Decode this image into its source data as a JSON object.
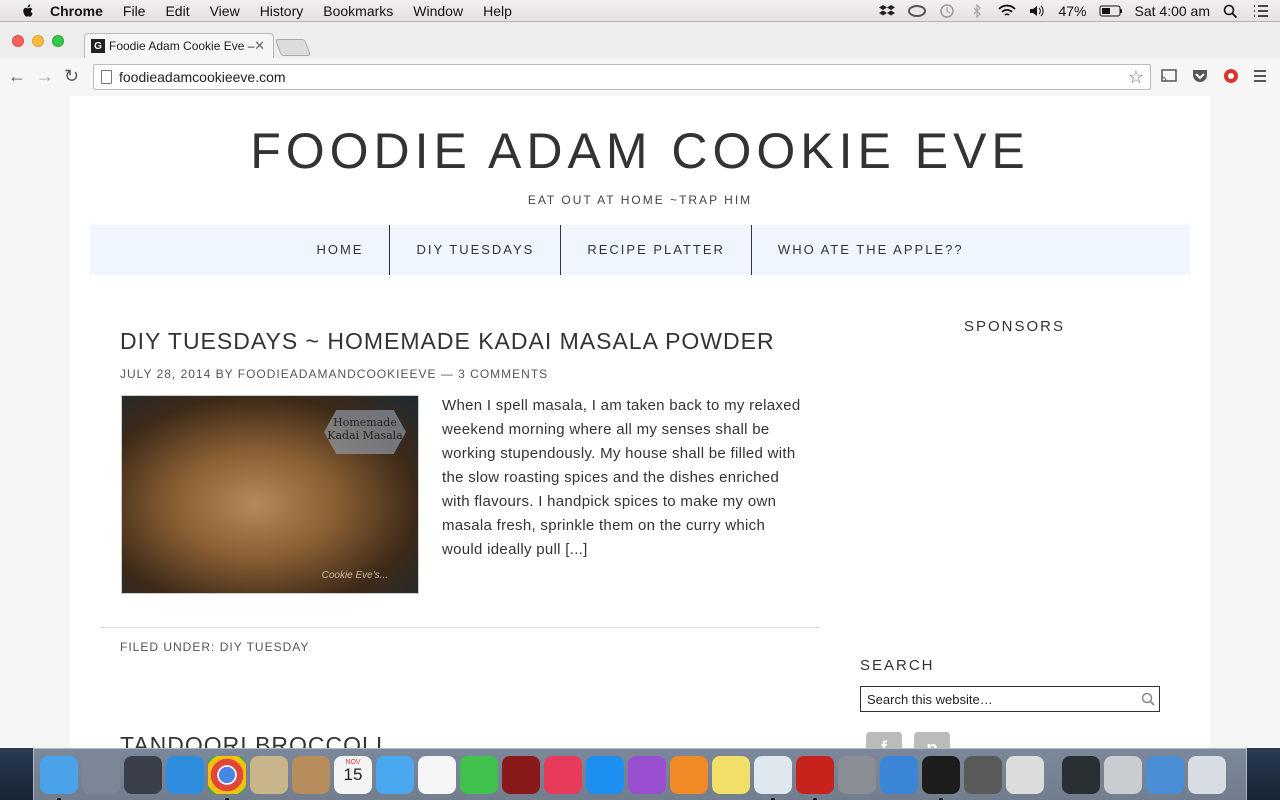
{
  "menubar": {
    "items": [
      "Chrome",
      "File",
      "Edit",
      "View",
      "History",
      "Bookmarks",
      "Window",
      "Help"
    ],
    "battery": "47%",
    "clock": "Sat 4:00 am"
  },
  "browser": {
    "tab_title": "Foodie Adam Cookie Eve –",
    "tab_favicon": "G",
    "url": "foodieadamcookieeve.com"
  },
  "site": {
    "title": "FOODIE ADAM COOKIE EVE",
    "tagline": "EAT OUT AT HOME ~TRAP HIM",
    "nav": [
      "HOME",
      "DIY TUESDAYS",
      "RECIPE PLATTER",
      "WHO ATE THE APPLE??"
    ]
  },
  "post": {
    "title": "DIY TUESDAYS ~ HOMEMADE KADAI MASALA POWDER",
    "date": "JULY 28, 2014",
    "by": "BY",
    "author": "FOODIEADAMANDCOOKIEEVE",
    "sep": "—",
    "comments": "3 COMMENTS",
    "image_label": "Homemade Kadai Masala",
    "image_watermark": "Cookie Eve's...",
    "excerpt": "When I spell masala, I am taken back to my relaxed weekend morning where all my senses shall be working stupendously.  My house shall be filled with the slow roasting spices and the dishes enriched with flavours. I handpick spices to make my own masala fresh, sprinkle them on the curry which would ideally pull [...]",
    "filed_label": "FILED UNDER:",
    "filed_category": "DIY TUESDAY"
  },
  "next_post": {
    "title": "TANDOORI BROCCOLI"
  },
  "sidebar": {
    "sponsors_heading": "SPONSORS",
    "search_heading": "SEARCH",
    "search_placeholder": "Search this website…",
    "social": [
      "f",
      "p"
    ]
  },
  "dock": {
    "icons": [
      "finder-icon",
      "launchpad-icon",
      "mission-control-icon",
      "safari-icon",
      "chrome-icon",
      "mail-icon",
      "contacts-icon",
      "calendar-icon",
      "messages-icon",
      "reminders-icon",
      "facetime-icon",
      "photo-booth-icon",
      "itunes-icon",
      "app-store-icon",
      "podcast-icon",
      "ibooks-icon",
      "notes-icon",
      "preview-icon",
      "acrobat-icon",
      "system-preferences-icon",
      "xcode-icon",
      "terminal-icon",
      "sublime-icon",
      "alfred-icon",
      "activity-monitor-icon",
      "mamp-icon",
      "folder-icon",
      "trash-icon"
    ],
    "calendar_month": "NOV",
    "calendar_day": "15"
  }
}
